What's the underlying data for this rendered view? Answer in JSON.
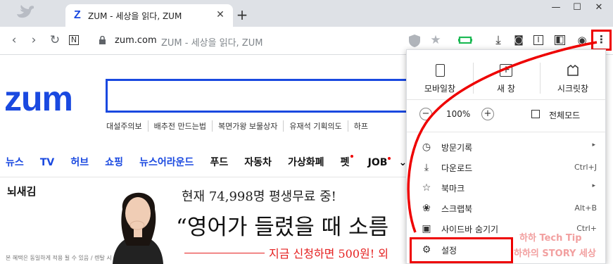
{
  "browser": {
    "tab": {
      "favicon": "Z",
      "title": "ZUM - 세상을 읽다, ZUM"
    },
    "new_tab_symbol": "+",
    "close_symbol": "✕",
    "window_controls": {
      "minimize": "—",
      "maximize": "☐",
      "close": "✕"
    },
    "address": {
      "host": "zum.com",
      "title_suffix": "ZUM - 세상을 읽다, ZUM"
    },
    "toolbar_icons": [
      "back-icon",
      "forward-icon",
      "reload-icon",
      "n-icon",
      "shield-icon",
      "star-icon",
      "extension-icon",
      "download-icon",
      "camera-icon",
      "reader-icon",
      "sidebar-icon",
      "profile-icon",
      "menu-icon"
    ],
    "menu_glyph": "⋮"
  },
  "page": {
    "logo": "ZUM",
    "quick_links": [
      "대설주의보",
      "배추전 만드는법",
      "복면가왕 보물상자",
      "유재석 기획의도",
      "하프"
    ],
    "nav": [
      {
        "label": "뉴스",
        "style": "blue"
      },
      {
        "label": "TV",
        "style": "blue"
      },
      {
        "label": "허브",
        "style": "blue"
      },
      {
        "label": "쇼핑",
        "style": "blue"
      },
      {
        "label": "뉴스어라운드",
        "style": "blue"
      },
      {
        "label": "푸드",
        "style": "dark"
      },
      {
        "label": "자동차",
        "style": "dark"
      },
      {
        "label": "가상화폐",
        "style": "dark"
      },
      {
        "label": "펫",
        "style": "dark",
        "dot": true
      },
      {
        "label": "JOB",
        "style": "dark",
        "dot": true
      }
    ],
    "nav_more": "⌄",
    "ad": {
      "section_title": "뇌새김",
      "line1": "현재 74,998명 평생무료 중!",
      "line2": "“영어가 들렸을 때 소름",
      "line3": "지금 신청하면 500원! 외",
      "footnote": "본 혜택은 동일하게 적용 될 수 있음 / 렌탈 시"
    }
  },
  "menu": {
    "top_buttons": [
      {
        "label": "모바일창",
        "icon": "mobile-icon",
        "glyph": ""
      },
      {
        "label": "새 창",
        "icon": "new-window-icon",
        "glyph": "+"
      },
      {
        "label": "시크릿창",
        "icon": "secret-icon",
        "glyph": ""
      }
    ],
    "zoom": {
      "minus": "−",
      "value": "100%",
      "plus": "+",
      "fullscreen": "전체모드"
    },
    "items": [
      {
        "label": "방문기록",
        "glyph": "◷",
        "shortcut": "",
        "submenu": true
      },
      {
        "label": "다운로드",
        "glyph": "⤓",
        "shortcut": "Ctrl+J",
        "submenu": false
      },
      {
        "label": "북마크",
        "glyph": "☆",
        "shortcut": "",
        "submenu": true
      },
      {
        "label": "스크랩북",
        "glyph": "❀",
        "shortcut": "Alt+B",
        "submenu": false
      },
      {
        "label": "사이드바 숨기기",
        "glyph": "▣",
        "shortcut": "Ctrl+",
        "submenu": false
      },
      {
        "label": "설정",
        "glyph": "⚙",
        "shortcut": "",
        "submenu": false
      }
    ],
    "arrow_glyph": "▸"
  },
  "watermark": {
    "line1": "하하 Tech Tip",
    "line2": "하하의 STORY 세상"
  },
  "colors": {
    "brand": "#1a49e0",
    "highlight_red": "#e00000"
  }
}
